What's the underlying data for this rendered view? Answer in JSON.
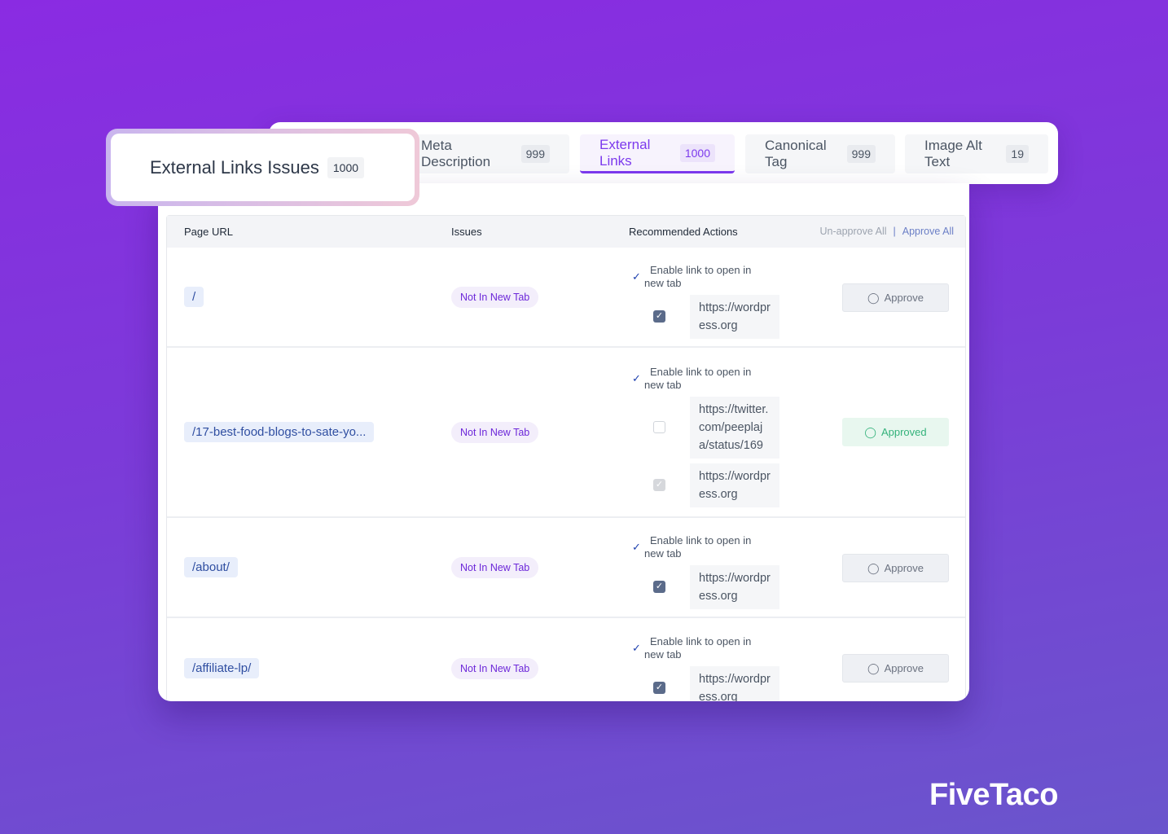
{
  "title_card": {
    "title": "External Links Issues",
    "count": "1000"
  },
  "tabs": [
    {
      "label": "Meta Description",
      "count": "999",
      "active": false
    },
    {
      "label": "External Links",
      "count": "1000",
      "active": true
    },
    {
      "label": "Canonical Tag",
      "count": "999",
      "active": false
    },
    {
      "label": "Image Alt Text",
      "count": "19",
      "active": false
    }
  ],
  "table": {
    "headers": {
      "url": "Page URL",
      "issues": "Issues",
      "actions": "Recommended Actions"
    },
    "unapprove_all": "Un-approve All",
    "separator": "|",
    "approve_all": "Approve All",
    "action_line1": "Enable link to open in",
    "action_line2": "new tab",
    "check_glyph": "✓",
    "rows": [
      {
        "url": "/",
        "issue": "Not In New Tab",
        "links": [
          {
            "url": "https://wordpress.org",
            "state": "checked"
          }
        ],
        "button": "Approve",
        "approved": false
      },
      {
        "url": "/17-best-food-blogs-to-sate-yo...",
        "issue": "Not In New Tab",
        "links": [
          {
            "url": "https://twitter.com/peeplaja/status/169",
            "state": "unchecked"
          },
          {
            "url": "https://wordpress.org",
            "state": "disabled-checked"
          }
        ],
        "button": "Approved",
        "approved": true
      },
      {
        "url": "/about/",
        "issue": "Not In New Tab",
        "links": [
          {
            "url": "https://wordpress.org",
            "state": "checked"
          }
        ],
        "button": "Approve",
        "approved": false
      },
      {
        "url": "/affiliate-lp/",
        "issue": "Not In New Tab",
        "links": [
          {
            "url": "https://wordpress.org",
            "state": "checked"
          }
        ],
        "button": "Approve",
        "approved": false
      }
    ]
  },
  "brand": "FiveTaco",
  "colors": {
    "accent": "#7c3aed",
    "approved": "#34b27b",
    "link_chip": "#2f4ea1"
  }
}
